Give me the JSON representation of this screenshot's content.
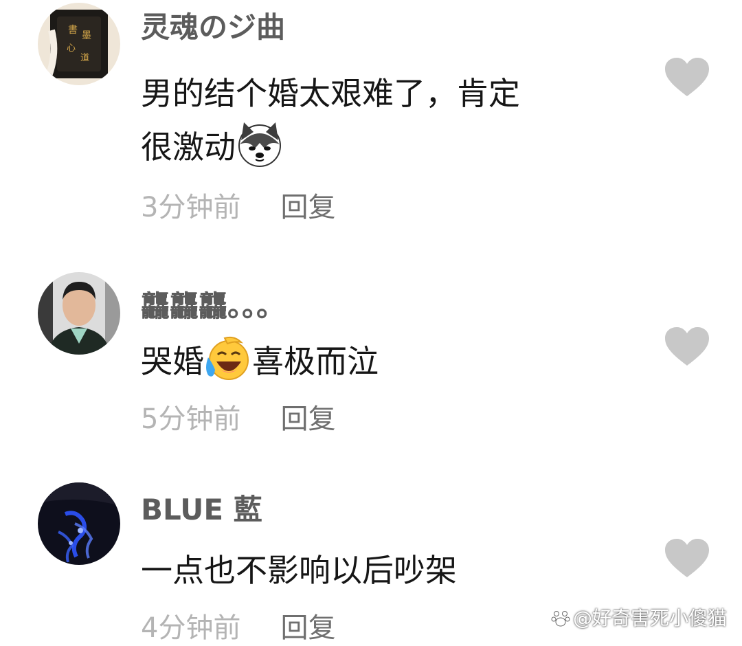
{
  "comments": [
    {
      "username": "灵魂のジ曲",
      "text_line1": "男的结个婚太艰难了，肯定",
      "text_line2": "很激动",
      "emoji": "husky-dog-emoji",
      "time": "3分钟前",
      "reply_label": "回复",
      "like_icon": "heart-icon"
    },
    {
      "username": "龘龘龘。。。",
      "text_before": "哭婚",
      "emoji": "laughing-crying-emoji",
      "text_after": "喜极而泣",
      "time": "5分钟前",
      "reply_label": "回复",
      "like_icon": "heart-icon"
    },
    {
      "username": "BLUE 藍",
      "text": "一点也不影响以后吵架",
      "time": "4分钟前",
      "reply_label": "回复",
      "like_icon": "heart-icon"
    }
  ],
  "watermark": "@好奇害死小傻猫",
  "colors": {
    "username": "#5c5c5c",
    "time": "#b4b4b4",
    "reply": "#6f6f6f",
    "heart": "#c8c8c8"
  }
}
